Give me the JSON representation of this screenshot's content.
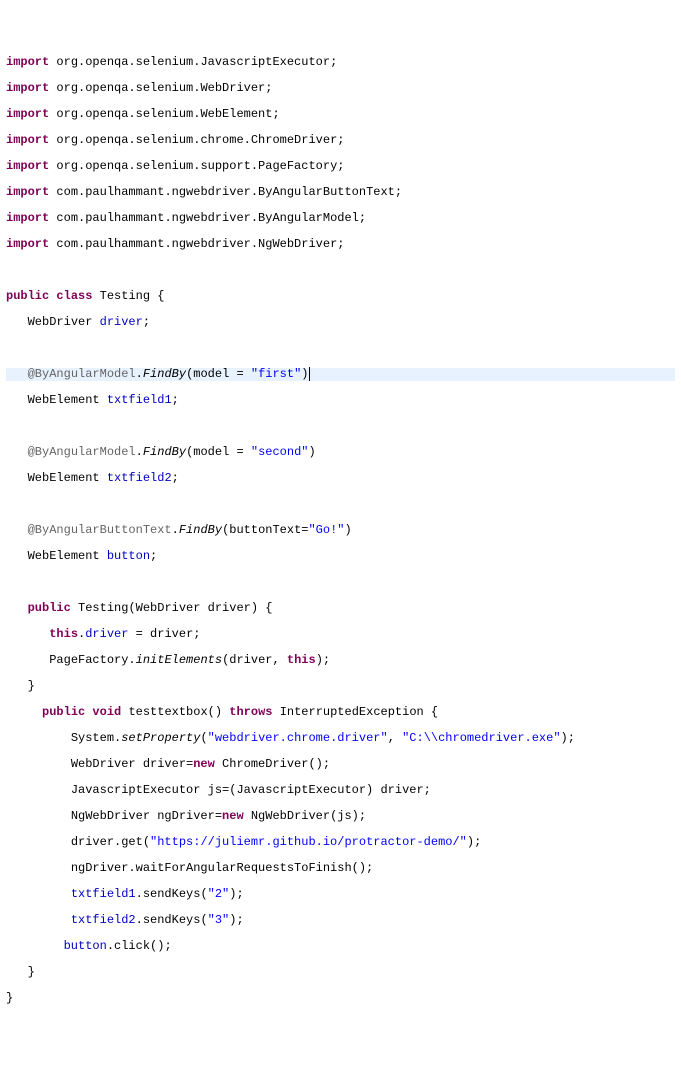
{
  "lines": {
    "l1": {
      "kw": "import",
      "pkg": " org.openqa.selenium.JavascriptExecutor;"
    },
    "l2": {
      "kw": "import",
      "pkg": " org.openqa.selenium.WebDriver;"
    },
    "l3": {
      "kw": "import",
      "pkg": " org.openqa.selenium.WebElement;"
    },
    "l4": {
      "kw": "import",
      "pkg": " org.openqa.selenium.chrome.ChromeDriver;"
    },
    "l5": {
      "kw": "import",
      "pkg": " org.openqa.selenium.support.PageFactory;"
    },
    "l6": {
      "kw": "import",
      "pkg": " com.paulhammant.ngwebdriver.ByAngularButtonText;"
    },
    "l7": {
      "kw": "import",
      "pkg": " com.paulhammant.ngwebdriver.ByAngularModel;"
    },
    "l8": {
      "kw": "import",
      "pkg": " com.paulhammant.ngwebdriver.NgWebDriver;"
    },
    "l10": {
      "kw1": "public",
      "kw2": " class",
      "name": " Testing {"
    },
    "l11": {
      "indent": "   ",
      "type": "WebDriver ",
      "name": "driver",
      "semi": ";"
    },
    "l13": {
      "indent": "   ",
      "ann": "@ByAngularModel",
      "dot": ".",
      "meth": "FindBy",
      "open": "(",
      "arg": "model = ",
      "str": "\"first\"",
      "close": ")"
    },
    "l14": {
      "indent": "   ",
      "type": "WebElement ",
      "name": "txtfield1",
      "semi": ";"
    },
    "l16": {
      "indent": "   ",
      "ann": "@ByAngularModel",
      "dot": ".",
      "meth": "FindBy",
      "open": "(",
      "arg": "model = ",
      "str": "\"second\"",
      "close": ")"
    },
    "l17": {
      "indent": "   ",
      "type": "WebElement ",
      "name": "txtfield2",
      "semi": ";"
    },
    "l19": {
      "indent": "   ",
      "ann": "@ByAngularButtonText",
      "dot": ".",
      "meth": "FindBy",
      "open": "(",
      "arg": "buttonText=",
      "str": "\"Go!\"",
      "close": ")"
    },
    "l20": {
      "indent": "   ",
      "type": "WebElement ",
      "name": "button",
      "semi": ";"
    },
    "l22": {
      "indent": "   ",
      "kw": "public",
      "name": " Testing(WebDriver driver) {"
    },
    "l23": {
      "indent": "      ",
      "kw": "this",
      "dot": ".",
      "fld": "driver",
      "rest": " = driver;"
    },
    "l24": {
      "indent": "      ",
      "cls": "PageFactory.",
      "meth": "initElements",
      "args": "(driver, ",
      "kw": "this",
      "close": ");"
    },
    "l25": {
      "indent": "   ",
      "close": "}"
    },
    "l26": {
      "indent": "     ",
      "kw1": "public",
      "kw2": " void",
      "name": " testtextbox() ",
      "kw3": "throws",
      "rest": " InterruptedException {"
    },
    "l27": {
      "indent": "         ",
      "cls": "System.",
      "meth": "setProperty",
      "open": "(",
      "str1": "\"webdriver.chrome.driver\"",
      "comma": ", ",
      "str2": "\"C:\\\\chromedriver.exe\"",
      "close": ");"
    },
    "l28": {
      "indent": "         ",
      "type": "WebDriver driver=",
      "kw": "new",
      "rest": " ChromeDriver();"
    },
    "l29": {
      "indent": "         ",
      "type": "JavascriptExecutor js=(JavascriptExecutor) driver;"
    },
    "l30": {
      "indent": "         ",
      "type": "NgWebDriver ngDriver=",
      "kw": "new",
      "rest": " NgWebDriver(js);"
    },
    "l31": {
      "indent": "         ",
      "obj": "driver.get(",
      "str": "\"https://juliemr.github.io/protractor-demo/\"",
      "close": ");"
    },
    "l32": {
      "indent": "         ",
      "obj": "ngDriver.waitForAngularRequestsToFinish();"
    },
    "l33": {
      "indent": "         ",
      "fld": "txtfield1",
      "dot": ".",
      "meth": "sendKeys",
      "open": "(",
      "str": "\"2\"",
      "close": ");"
    },
    "l34": {
      "indent": "         ",
      "fld": "txtfield2",
      "dot": ".",
      "meth": "sendKeys",
      "open": "(",
      "str": "\"3\"",
      "close": ");"
    },
    "l35": {
      "indent": "        ",
      "fld": "button",
      "dot": ".",
      "meth": "click",
      "close": "();"
    },
    "l36": {
      "indent": "   ",
      "close": "}"
    },
    "l37": {
      "close": "}"
    }
  }
}
